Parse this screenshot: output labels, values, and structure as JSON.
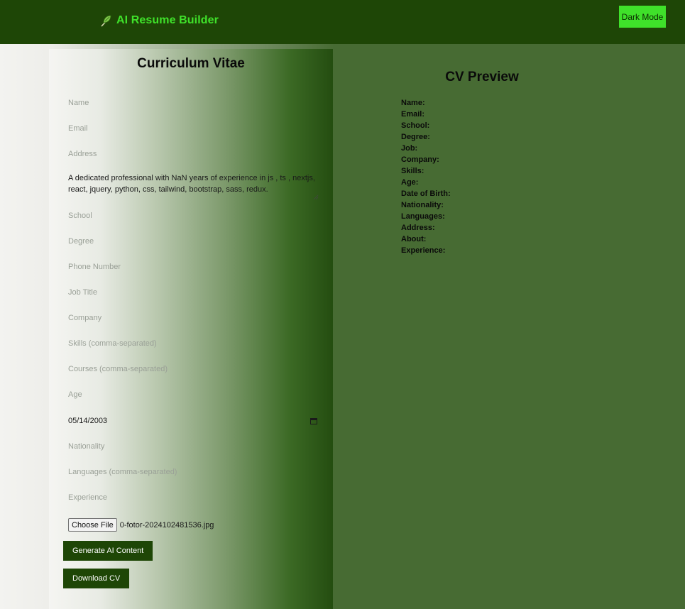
{
  "header": {
    "app_title": "AI Resume Builder",
    "dark_mode_label": "Dark Mode",
    "brand_color": "#3fe12a",
    "bar_color": "#1e4606"
  },
  "form": {
    "title": "Curriculum Vitae",
    "name_placeholder": "Name",
    "email_placeholder": "Email",
    "address_placeholder": "Address",
    "about_value": "A dedicated professional with NaN years of experience in js , ts , nextjs, react, jquery, python, css, tailwind, bootstrap, sass, redux.",
    "school_placeholder": "School",
    "degree_placeholder": "Degree",
    "phone_placeholder": "Phone Number",
    "job_placeholder": "Job Title",
    "company_placeholder": "Company",
    "skills_placeholder": "Skills (comma-separated)",
    "courses_placeholder": "Courses (comma-separated)",
    "age_placeholder": "Age",
    "dob_value": "05/14/2003",
    "nationality_placeholder": "Nationality",
    "languages_placeholder": "Languages (comma-separated)",
    "experience_placeholder": "Experience",
    "file_button_label": "Choose File",
    "file_name": "0-fotor-2024102481536.jpg",
    "generate_label": "Generate AI Content",
    "download_label": "Download CV"
  },
  "preview": {
    "title": "CV Preview",
    "labels": [
      "Name:",
      "Email:",
      "School:",
      "Degree:",
      "Job:",
      "Company:",
      "Skills:",
      "Age:",
      "Date of Birth:",
      "Nationality:",
      "Languages:",
      "Address:",
      "About:",
      "Experience:"
    ]
  }
}
